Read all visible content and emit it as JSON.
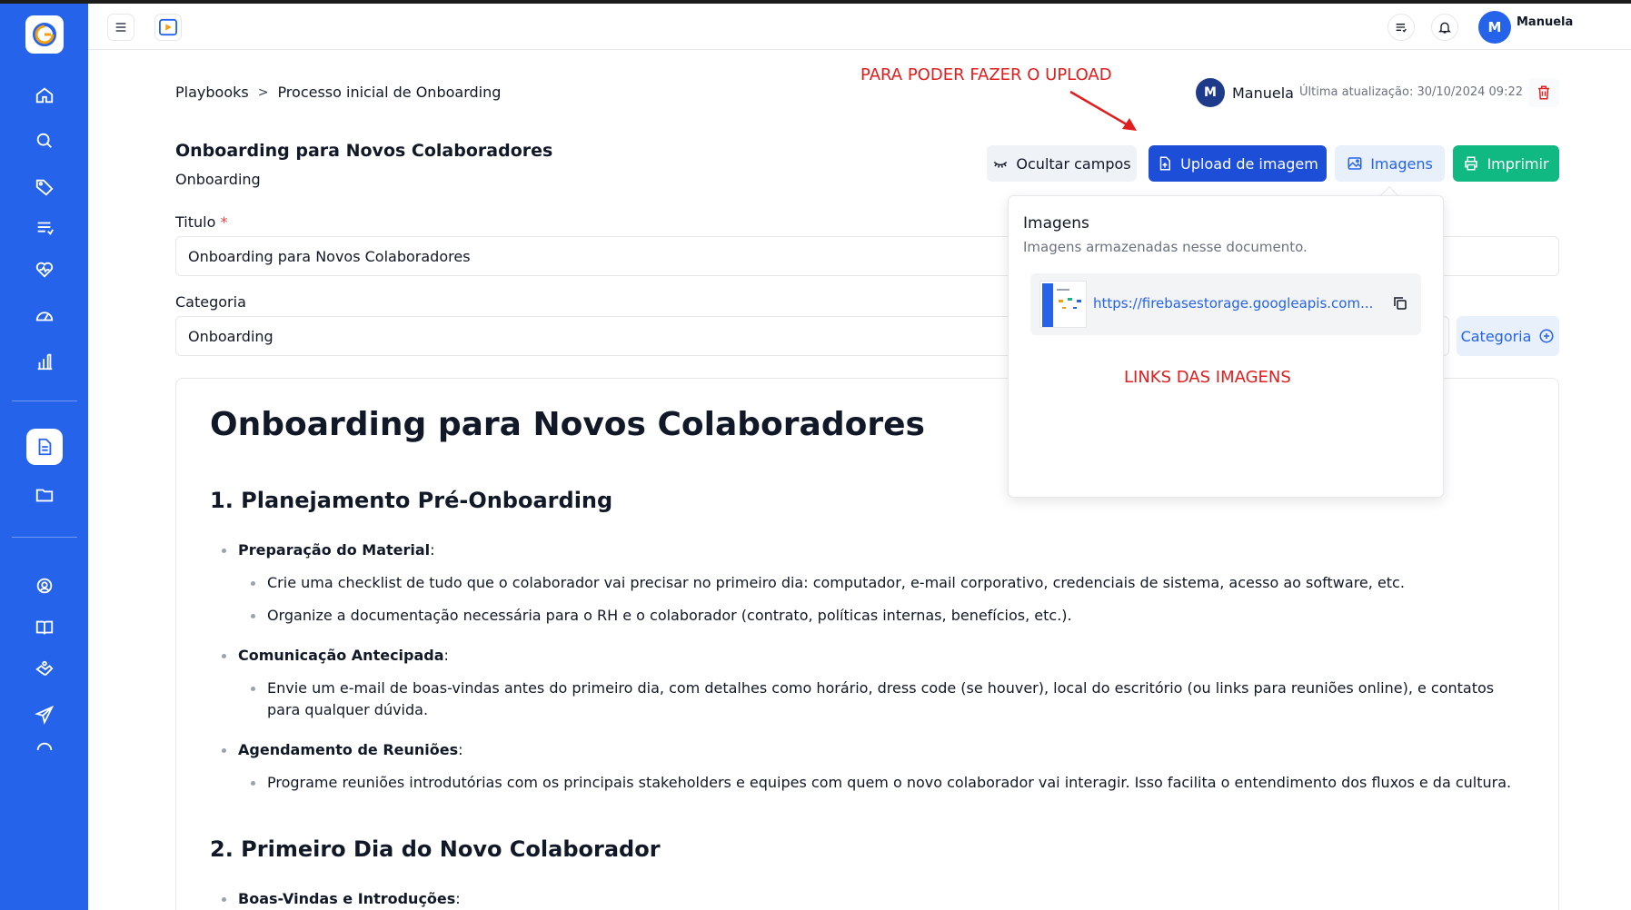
{
  "header": {
    "user_initial": "M",
    "user_name": "Manuela"
  },
  "sidebar": {
    "items": [
      {
        "icon": "home-icon"
      },
      {
        "icon": "search-icon"
      },
      {
        "icon": "tag-icon"
      },
      {
        "icon": "list-icon"
      },
      {
        "icon": "heart-pulse-icon"
      },
      {
        "icon": "gauge-icon"
      },
      {
        "icon": "bar-chart-icon"
      },
      {
        "icon": "document-icon",
        "active": true
      },
      {
        "icon": "folder-icon"
      },
      {
        "icon": "support-icon"
      },
      {
        "icon": "book-icon"
      },
      {
        "icon": "handshake-icon"
      },
      {
        "icon": "send-icon"
      }
    ]
  },
  "breadcrumb": {
    "root": "Playbooks",
    "separator": ">",
    "current": "Processo inicial de Onboarding"
  },
  "annotations": {
    "upload_note": "PARA PODER FAZER O UPLOAD",
    "links_note": "LINKS DAS IMAGENS"
  },
  "meta": {
    "editor_initial": "M",
    "editor_name": "Manuela",
    "last_update": "Última atualização: 30/10/2024 09:22"
  },
  "document": {
    "title": "Onboarding para Novos Colaboradores",
    "category": "Onboarding"
  },
  "toolbar": {
    "hide_fields_label": "Ocultar campos",
    "upload_label": "Upload de imagem",
    "images_label": "Imagens",
    "print_label": "Imprimir"
  },
  "form": {
    "title_label": "Titulo",
    "title_required_mark": "*",
    "title_value": "Onboarding para Novos Colaboradores",
    "category_label": "Categoria",
    "category_value": "Onboarding",
    "category_button_label": "Categoria"
  },
  "images_popover": {
    "title": "Imagens",
    "description": "Imagens armazenadas nesse documento.",
    "images": [
      {
        "url": "https://firebasestorage.googleapis.com..."
      }
    ]
  },
  "content": {
    "h1": "Onboarding para Novos Colaboradores",
    "section1": {
      "heading": "1. Planejamento Pré-Onboarding",
      "item1_title": "Preparação do Material",
      "item1_sub1": "Crie uma checklist de tudo que o colaborador vai precisar no primeiro dia: computador, e-mail corporativo, credenciais de sistema, acesso ao software, etc.",
      "item1_sub2": "Organize a documentação necessária para o RH e o colaborador (contrato, políticas internas, benefícios, etc.).",
      "item2_title": "Comunicação Antecipada",
      "item2_sub1": "Envie um e-mail de boas-vindas antes do primeiro dia, com detalhes como horário, dress code (se houver), local do escritório (ou links para reuniões online), e contatos para qualquer dúvida.",
      "item3_title": "Agendamento de Reuniões",
      "item3_sub1": "Programe reuniões introdutórias com os principais stakeholders e equipes com quem o novo colaborador vai interagir. Isso facilita o entendimento dos fluxos e da cultura."
    },
    "section2": {
      "heading": "2. Primeiro Dia do Novo Colaborador",
      "item1_title": "Boas-Vindas e Introduções"
    },
    "colon": ":"
  }
}
